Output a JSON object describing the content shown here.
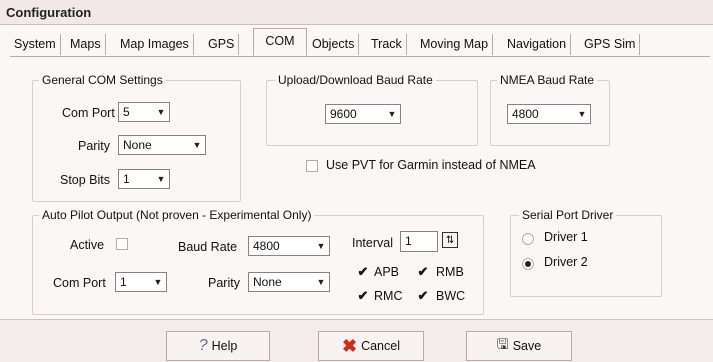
{
  "window": {
    "title": "Configuration"
  },
  "tabs": [
    "System",
    "Maps",
    "Map Images",
    "GPS",
    "COM",
    "Objects",
    "Track",
    "Moving Map",
    "Navigation",
    "GPS Sim"
  ],
  "general": {
    "legend": "General COM Settings",
    "com_port_label": "Com Port",
    "com_port_value": "5",
    "parity_label": "Parity",
    "parity_value": "None",
    "stop_bits_label": "Stop Bits",
    "stop_bits_value": "1"
  },
  "upload": {
    "legend": "Upload/Download Baud Rate",
    "value": "9600"
  },
  "nmea": {
    "legend": "NMEA Baud Rate",
    "value": "4800"
  },
  "pvt": {
    "label": "Use PVT for Garmin instead of NMEA",
    "checked": false
  },
  "autopilot": {
    "legend": "Auto Pilot Output  (Not proven - Experimental Only)",
    "active_label": "Active",
    "baud_label": "Baud Rate",
    "baud_value": "4800",
    "interval_label": "Interval",
    "interval_value": "1",
    "com_port_label": "Com Port",
    "com_port_value": "1",
    "parity_label": "Parity",
    "parity_value": "None",
    "sentences": [
      {
        "label": "APB",
        "checked": true
      },
      {
        "label": "RMB",
        "checked": true
      },
      {
        "label": "RMC",
        "checked": true
      },
      {
        "label": "BWC",
        "checked": true
      }
    ]
  },
  "serial": {
    "legend": "Serial Port Driver",
    "driver1": "Driver 1",
    "driver2": "Driver 2",
    "selected": "Driver 2"
  },
  "buttons": {
    "help": "Help",
    "cancel": "Cancel",
    "save": "Save"
  },
  "icons": {
    "help": "question-icon",
    "cancel": "x-icon",
    "save": "disk-icon"
  },
  "colors": {
    "cancel_x": "#d42a1c",
    "help_q": "#6a6a9a"
  }
}
